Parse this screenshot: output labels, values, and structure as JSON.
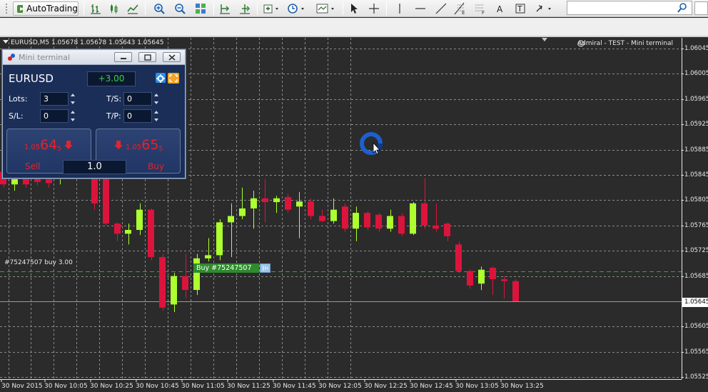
{
  "toolbar": {
    "autotrading_label": "AutoTrading",
    "icons": [
      "new-chart-icon",
      "autotrading-icon",
      "bar-chart-icon",
      "candlestick-icon",
      "line-chart-icon",
      "zoom-in-icon",
      "zoom-out-icon",
      "tile-windows-icon",
      "chart-shift-icon",
      "autoscroll-icon",
      "add-indicator-icon",
      "periods-icon",
      "templates-icon",
      "cursor-icon",
      "crosshair-icon",
      "vertical-line-icon",
      "horizontal-line-icon",
      "trendline-icon",
      "fibonacci-icon",
      "fibo-fan-icon",
      "text-icon",
      "text-label-icon",
      "arrows-icon",
      "search-icon"
    ]
  },
  "chart": {
    "symbol_line": "EURUSD,M5  1.05678 1.05678 1.05643 1.05645",
    "account_line": "Admiral - TEST - Mini terminal",
    "price_axis": [
      "1.06045",
      "1.06005",
      "1.05965",
      "1.05925",
      "1.05885",
      "1.05845",
      "1.05805",
      "1.05765",
      "1.05725",
      "1.05685",
      "1.05645",
      "1.05605",
      "1.05565",
      "1.05525"
    ],
    "current_price": "1.05645",
    "time_axis": [
      "30 Nov 2015",
      "30 Nov 10:05",
      "30 Nov 10:25",
      "30 Nov 10:45",
      "30 Nov 11:05",
      "30 Nov 11:25",
      "30 Nov 11:45",
      "30 Nov 12:05",
      "30 Nov 12:25",
      "30 Nov 12:45",
      "30 Nov 13:05",
      "30 Nov 13:25"
    ],
    "order_label": "#75247507 buy 3.00",
    "buy_tag": "Buy #75247507",
    "order_level": 1.05692,
    "colors": {
      "bull": "#adff2f",
      "bear": "#dc143c",
      "grid": "#8a8a8a",
      "order_line": "#2ea82e",
      "background": "#2b2b2b"
    },
    "candles": [
      {
        "o": 1.0585,
        "h": 1.05855,
        "l": 1.05825,
        "c": 1.0583
      },
      {
        "o": 1.0583,
        "h": 1.05852,
        "l": 1.0582,
        "c": 1.05848
      },
      {
        "o": 1.0585,
        "h": 1.05855,
        "l": 1.05825,
        "c": 1.0583
      },
      {
        "o": 1.05848,
        "h": 1.0585,
        "l": 1.05828,
        "c": 1.05834
      },
      {
        "o": 1.05838,
        "h": 1.0584,
        "l": 1.05825,
        "c": 1.05832
      },
      {
        "o": 1.0584,
        "h": 1.0587,
        "l": 1.0583,
        "c": 1.0586
      },
      {
        "o": 1.0586,
        "h": 1.05878,
        "l": 1.05838,
        "c": 1.05842
      },
      {
        "o": 1.05845,
        "h": 1.05865,
        "l": 1.0584,
        "c": 1.0586
      },
      {
        "o": 1.0586,
        "h": 1.05872,
        "l": 1.0579,
        "c": 1.058
      },
      {
        "o": 1.05845,
        "h": 1.0585,
        "l": 1.05765,
        "c": 1.05768
      },
      {
        "o": 1.05768,
        "h": 1.0577,
        "l": 1.0574,
        "c": 1.05752
      },
      {
        "o": 1.05752,
        "h": 1.05768,
        "l": 1.05735,
        "c": 1.05758
      },
      {
        "o": 1.05758,
        "h": 1.058,
        "l": 1.0575,
        "c": 1.0579
      },
      {
        "o": 1.0579,
        "h": 1.05792,
        "l": 1.0571,
        "c": 1.05715
      },
      {
        "o": 1.05715,
        "h": 1.0572,
        "l": 1.0563,
        "c": 1.05635
      },
      {
        "o": 1.0564,
        "h": 1.0569,
        "l": 1.05628,
        "c": 1.05685
      },
      {
        "o": 1.05685,
        "h": 1.0572,
        "l": 1.0565,
        "c": 1.05663
      },
      {
        "o": 1.05663,
        "h": 1.0572,
        "l": 1.05655,
        "c": 1.05713
      },
      {
        "o": 1.05713,
        "h": 1.05745,
        "l": 1.05708,
        "c": 1.05718
      },
      {
        "o": 1.05718,
        "h": 1.05775,
        "l": 1.0571,
        "c": 1.0577
      },
      {
        "o": 1.0577,
        "h": 1.058,
        "l": 1.05715,
        "c": 1.0578
      },
      {
        "o": 1.0578,
        "h": 1.05825,
        "l": 1.05775,
        "c": 1.05792
      },
      {
        "o": 1.05792,
        "h": 1.0582,
        "l": 1.0576,
        "c": 1.05808
      },
      {
        "o": 1.05808,
        "h": 1.05838,
        "l": 1.0577,
        "c": 1.05802
      },
      {
        "o": 1.05802,
        "h": 1.05812,
        "l": 1.05785,
        "c": 1.05808
      },
      {
        "o": 1.0581,
        "h": 1.05815,
        "l": 1.05785,
        "c": 1.0579
      },
      {
        "o": 1.05795,
        "h": 1.05818,
        "l": 1.05745,
        "c": 1.05803
      },
      {
        "o": 1.05803,
        "h": 1.05808,
        "l": 1.05775,
        "c": 1.0578
      },
      {
        "o": 1.0578,
        "h": 1.0579,
        "l": 1.0577,
        "c": 1.05772
      },
      {
        "o": 1.05772,
        "h": 1.05808,
        "l": 1.05768,
        "c": 1.0579
      },
      {
        "o": 1.05795,
        "h": 1.058,
        "l": 1.05755,
        "c": 1.0576
      },
      {
        "o": 1.0576,
        "h": 1.05795,
        "l": 1.0574,
        "c": 1.05785
      },
      {
        "o": 1.05785,
        "h": 1.05788,
        "l": 1.05758,
        "c": 1.05762
      },
      {
        "o": 1.05782,
        "h": 1.05785,
        "l": 1.05755,
        "c": 1.0576
      },
      {
        "o": 1.0576,
        "h": 1.0579,
        "l": 1.05755,
        "c": 1.0578
      },
      {
        "o": 1.0578,
        "h": 1.05785,
        "l": 1.05748,
        "c": 1.05752
      },
      {
        "o": 1.05752,
        "h": 1.05802,
        "l": 1.0575,
        "c": 1.058
      },
      {
        "o": 1.058,
        "h": 1.0584,
        "l": 1.0576,
        "c": 1.05765
      },
      {
        "o": 1.05765,
        "h": 1.058,
        "l": 1.05755,
        "c": 1.0576
      },
      {
        "o": 1.05768,
        "h": 1.0577,
        "l": 1.0574,
        "c": 1.05748
      },
      {
        "o": 1.05735,
        "h": 1.0574,
        "l": 1.0569,
        "c": 1.05693
      },
      {
        "o": 1.05693,
        "h": 1.05695,
        "l": 1.05665,
        "c": 1.0567
      },
      {
        "o": 1.05673,
        "h": 1.057,
        "l": 1.05663,
        "c": 1.05695
      },
      {
        "o": 1.05698,
        "h": 1.057,
        "l": 1.05655,
        "c": 1.0568
      },
      {
        "o": 1.0568,
        "h": 1.05685,
        "l": 1.0565,
        "c": 1.05677
      },
      {
        "o": 1.05677,
        "h": 1.0568,
        "l": 1.05645,
        "c": 1.05645
      }
    ]
  },
  "mini_terminal": {
    "title": "Mini terminal",
    "symbol": "EURUSD",
    "profit": "+3.00",
    "lots_label": "Lots:",
    "lots_value": "3",
    "ts_label": "T/S:",
    "ts_value": "0",
    "sl_label": "S/L:",
    "sl_value": "0",
    "tp_label": "T/P:",
    "tp_value": "0",
    "sell_price_prefix": "1.05",
    "sell_price_big": "64",
    "sell_price_sup": "5",
    "buy_price_prefix": "1.05",
    "buy_price_big": "65",
    "buy_price_sup": "5",
    "sell_label": "Sell",
    "buy_label": "Buy",
    "volume": "1.0"
  }
}
